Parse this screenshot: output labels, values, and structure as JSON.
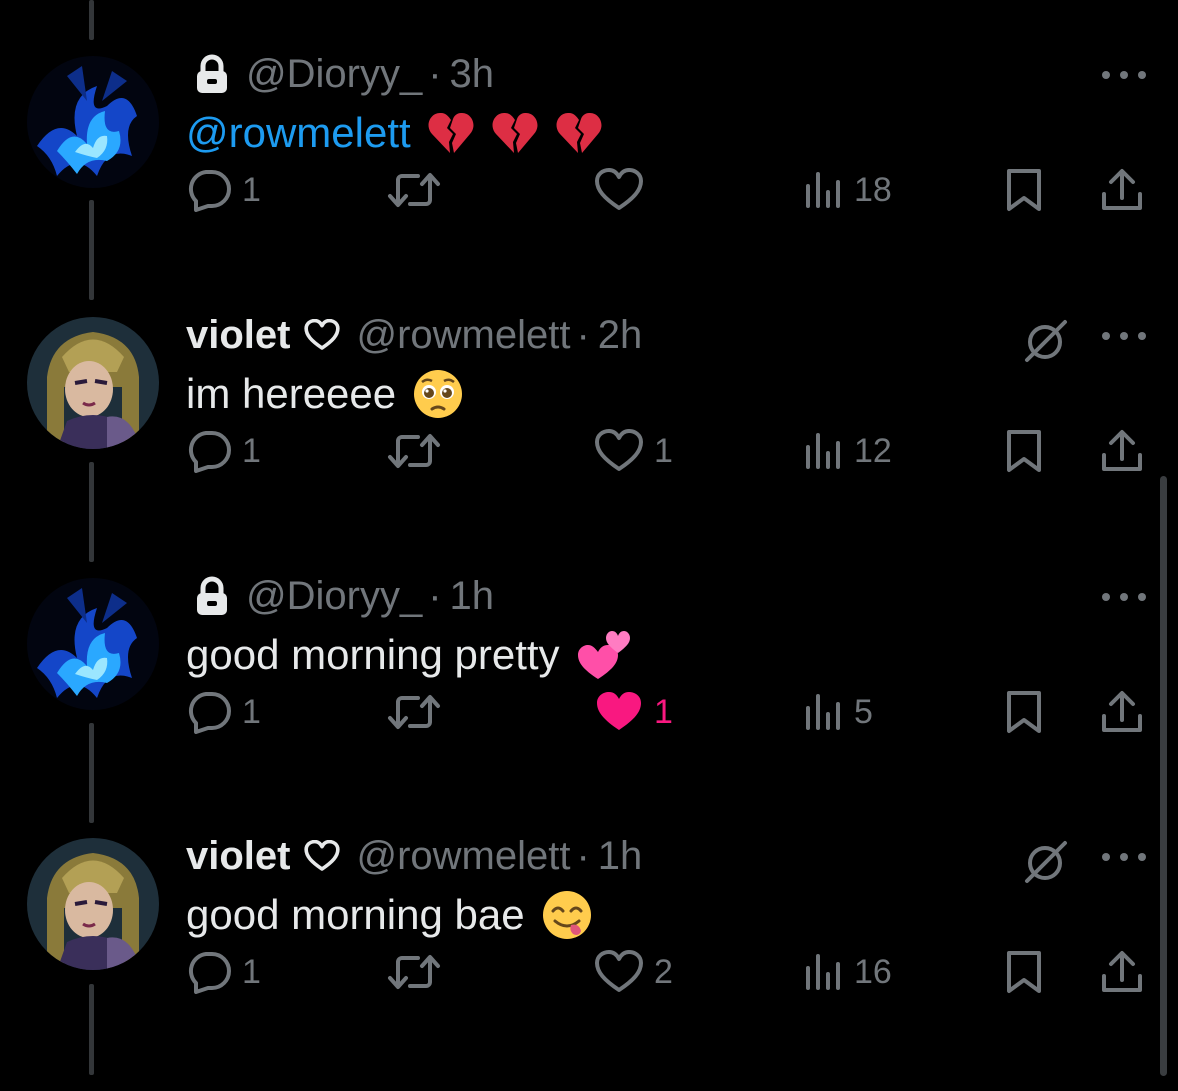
{
  "colors": {
    "background": "#000000",
    "text": "#e7e9ea",
    "secondary": "#71767b",
    "mention": "#1d9bf0",
    "like_active": "#f91880",
    "thread_line": "#333639"
  },
  "tweets": [
    {
      "author_name": "",
      "protected": true,
      "handle": "@Dioryy_",
      "separator": "·",
      "time": "3h",
      "text_mention": "@rowmelett",
      "text": "",
      "emojis": [
        "broken-heart",
        "broken-heart",
        "broken-heart"
      ],
      "avatar": "blue-flame-avatar",
      "replies": "1",
      "retweets": "",
      "likes": "",
      "liked": false,
      "views": "18",
      "grok_icon": false
    },
    {
      "author_name": "violet",
      "name_icon": "heart-outline",
      "protected": false,
      "handle": "@rowmelett",
      "separator": "·",
      "time": "2h",
      "text_mention": "",
      "text": "im hereeee",
      "emojis": [
        "pleading-face"
      ],
      "avatar": "anime-girl-avatar",
      "replies": "1",
      "retweets": "",
      "likes": "1",
      "liked": false,
      "views": "12",
      "grok_icon": true
    },
    {
      "author_name": "",
      "protected": true,
      "handle": "@Dioryy_",
      "separator": "·",
      "time": "1h",
      "text_mention": "",
      "text": "good morning pretty",
      "emojis": [
        "two-hearts"
      ],
      "avatar": "blue-flame-avatar",
      "replies": "1",
      "retweets": "",
      "likes": "1",
      "liked": true,
      "views": "5",
      "grok_icon": false
    },
    {
      "author_name": "violet",
      "name_icon": "heart-outline",
      "protected": false,
      "handle": "@rowmelett",
      "separator": "·",
      "time": "1h",
      "text_mention": "",
      "text": "good morning bae",
      "emojis": [
        "yum-face"
      ],
      "avatar": "anime-girl-avatar",
      "replies": "1",
      "retweets": "",
      "likes": "2",
      "liked": false,
      "views": "16",
      "grok_icon": true
    }
  ]
}
